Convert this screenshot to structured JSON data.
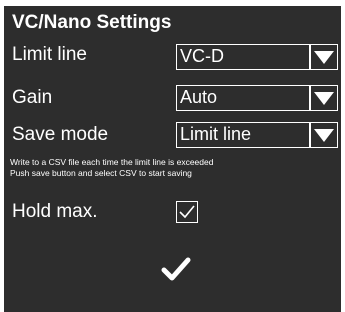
{
  "dialog": {
    "title": "VC/Nano Settings",
    "limit_line": {
      "label": "Limit line",
      "value": "VC-D"
    },
    "gain": {
      "label": "Gain",
      "value": "Auto"
    },
    "save_mode": {
      "label": "Save mode",
      "value": "Limit line"
    },
    "notes": [
      "Write to a CSV file each time the limit line is exceeded",
      "Push save button and select CSV to start saving"
    ],
    "hold_max": {
      "label": "Hold max.",
      "checked": true
    },
    "confirm_icon": "checkmark-icon"
  },
  "colors": {
    "background": "#2d2d2d",
    "foreground": "#ffffff"
  }
}
